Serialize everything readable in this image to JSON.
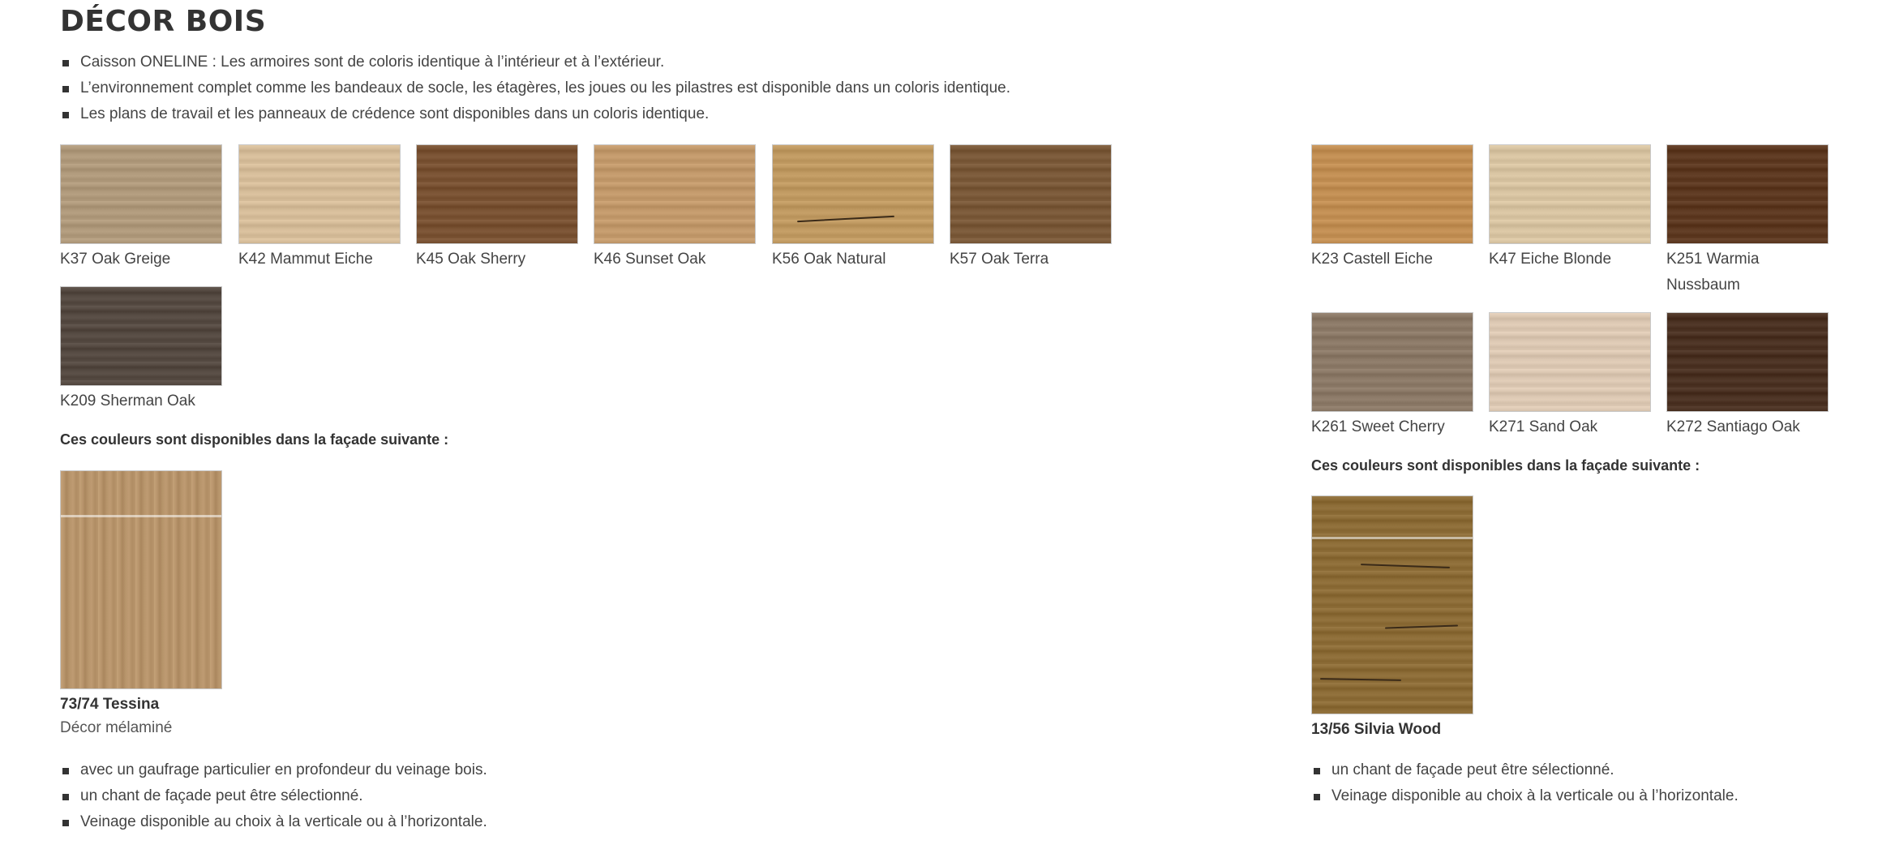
{
  "title": "DÉCOR BOIS",
  "intro_bullets": [
    "Caisson ONELINE : Les armoires sont de coloris identique à l’intérieur et à l’extérieur.",
    "L’environnement complet comme les bandeaux de socle, les étagères, les joues ou les pilastres est disponible dans un coloris identique.",
    "Les plans de travail et les panneaux de crédence sont disponibles dans un coloris identique."
  ],
  "left": {
    "swatches": [
      {
        "label": "K37 Oak Greige",
        "color": "#b09a7c"
      },
      {
        "label": "K42 Mammut Eiche",
        "color": "#d6bd9a"
      },
      {
        "label": "K45 Oak Sherry",
        "color": "#7a5334"
      },
      {
        "label": "K46 Sunset Oak",
        "color": "#c39a6c"
      },
      {
        "label": "K56 Oak Natural",
        "color": "#c09a62"
      },
      {
        "label": "K57 Oak Terra",
        "color": "#7b5a3a"
      },
      {
        "label": "K209 Sherman Oak",
        "color": "#564b43"
      }
    ],
    "note": "Ces couleurs sont disponibles dans la façade suivante :",
    "facade": {
      "name": "73/74 Tessina",
      "sub": "Décor mélaminé",
      "color": "#b8956c"
    },
    "bullets": [
      "avec un gaufrage particulier en profondeur du veinage bois.",
      "un chant de façade peut être sélectionné.",
      "Veinage disponible au choix à la verticale ou à l’horizontale."
    ]
  },
  "right": {
    "swatches": [
      {
        "label": "K23 Castell Eiche",
        "color": "#c28f54"
      },
      {
        "label": "K47 Eiche Blonde",
        "color": "#d8c4a2"
      },
      {
        "label": "K251 Warmia Nussbaum",
        "color": "#5e3a22"
      },
      {
        "label": "K261 Sweet Cherry",
        "color": "#8c7a68"
      },
      {
        "label": "K271 Sand Oak",
        "color": "#dcc8b3"
      },
      {
        "label": "K272 Santiago Oak",
        "color": "#4c3324"
      }
    ],
    "note": "Ces couleurs sont disponibles dans la façade suivante :",
    "facade": {
      "name": "13/56 Silvia Wood",
      "color": "#8d6d38"
    },
    "bullets": [
      "un chant de façade peut être sélectionné.",
      "Veinage disponible au choix à la verticale ou à l’horizontale."
    ]
  }
}
